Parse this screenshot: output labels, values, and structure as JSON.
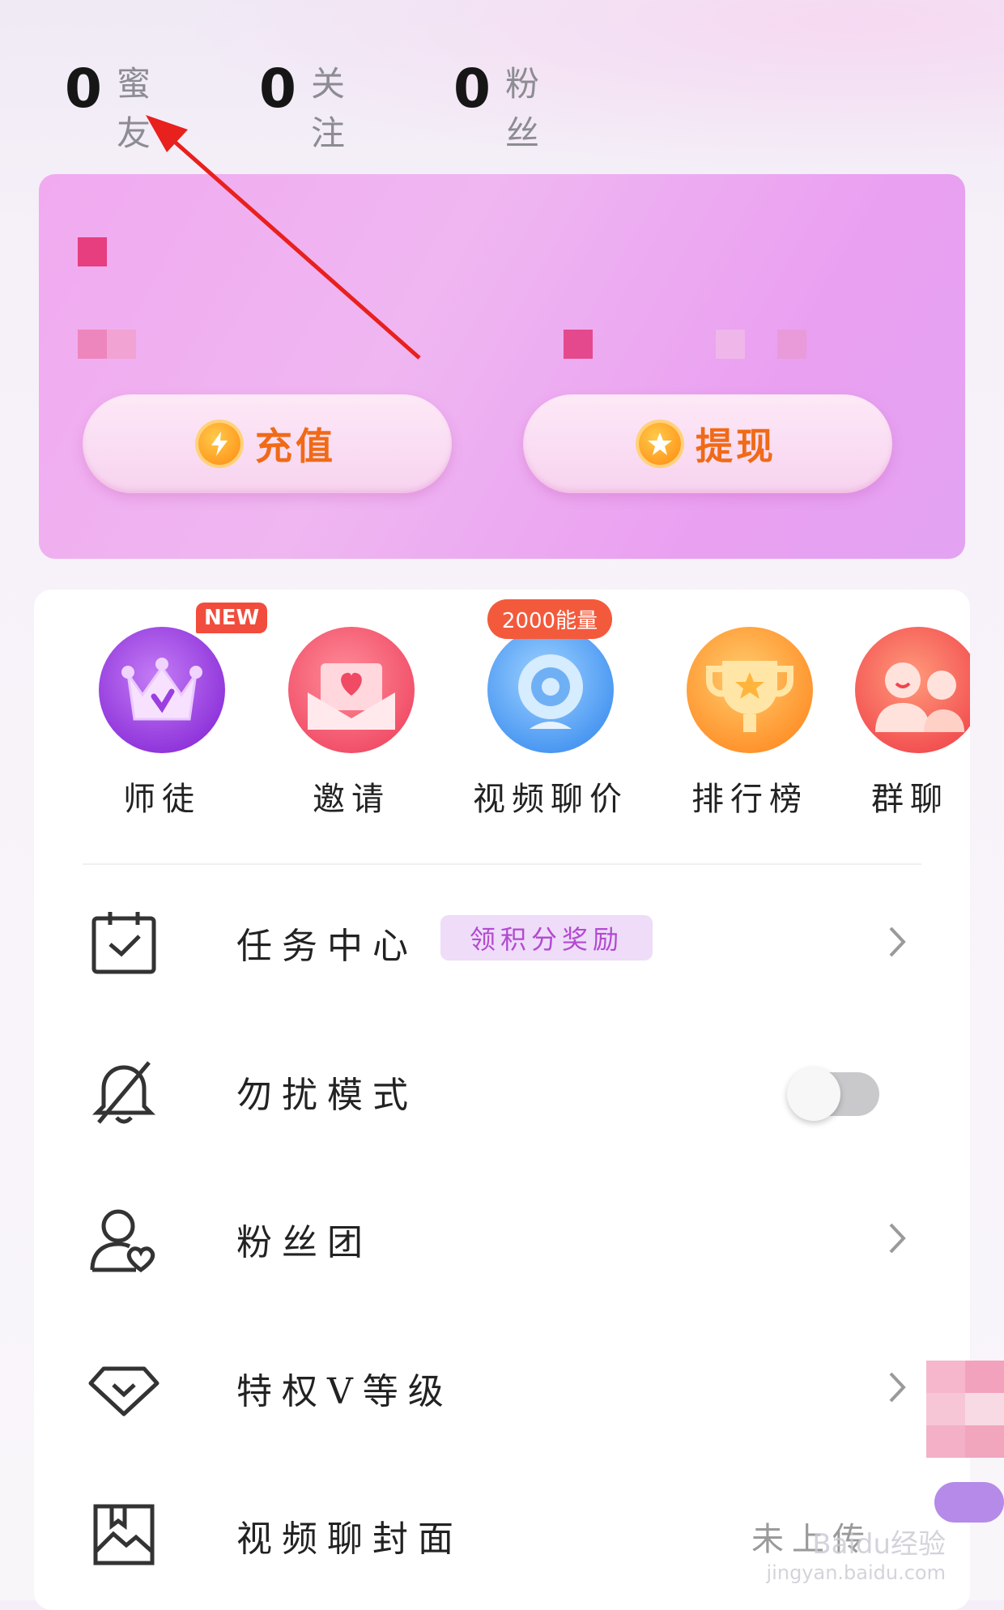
{
  "stats": [
    {
      "value": "0",
      "label": "蜜友"
    },
    {
      "value": "0",
      "label": "关注"
    },
    {
      "value": "0",
      "label": "粉丝"
    }
  ],
  "wallet": {
    "recharge_label": "充值",
    "withdraw_label": "提现"
  },
  "quick_actions": [
    {
      "label": "师徒",
      "badge": "NEW",
      "icon": "crown-icon"
    },
    {
      "label": "邀请",
      "icon": "invite-envelope-icon"
    },
    {
      "label": "视频聊价",
      "badge": "2000能量",
      "icon": "webcam-icon"
    },
    {
      "label": "排行榜",
      "icon": "trophy-icon"
    },
    {
      "label": "群聊",
      "icon": "group-chat-icon"
    }
  ],
  "menu": [
    {
      "label": "任务中心",
      "tag": "领积分奖励",
      "icon": "calendar-check-icon"
    },
    {
      "label": "勿扰模式",
      "toggle_on": false,
      "icon": "bell-off-icon"
    },
    {
      "label": "粉丝团",
      "icon": "fan-club-icon"
    },
    {
      "label": "特权V等级",
      "icon": "diamond-heart-icon"
    },
    {
      "label": "视频聊封面",
      "status": "未上传",
      "icon": "image-icon"
    }
  ],
  "watermark": {
    "brand": "Baidu经验",
    "url": "jingyan.baidu.com"
  },
  "colors": {
    "accent_orange": "#f06a17",
    "wallet_pink": "#eeaaf0",
    "badge_red": "#f24c3c",
    "tag_purple": "#b34ad0",
    "arrow_red": "#e8201e"
  }
}
